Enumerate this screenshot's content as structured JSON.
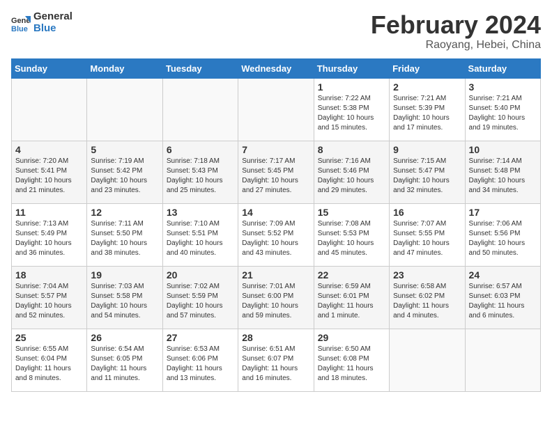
{
  "header": {
    "logo_line1": "General",
    "logo_line2": "Blue",
    "month_year": "February 2024",
    "location": "Raoyang, Hebei, China"
  },
  "weekdays": [
    "Sunday",
    "Monday",
    "Tuesday",
    "Wednesday",
    "Thursday",
    "Friday",
    "Saturday"
  ],
  "weeks": [
    [
      {
        "day": "",
        "info": ""
      },
      {
        "day": "",
        "info": ""
      },
      {
        "day": "",
        "info": ""
      },
      {
        "day": "",
        "info": ""
      },
      {
        "day": "1",
        "info": "Sunrise: 7:22 AM\nSunset: 5:38 PM\nDaylight: 10 hours\nand 15 minutes."
      },
      {
        "day": "2",
        "info": "Sunrise: 7:21 AM\nSunset: 5:39 PM\nDaylight: 10 hours\nand 17 minutes."
      },
      {
        "day": "3",
        "info": "Sunrise: 7:21 AM\nSunset: 5:40 PM\nDaylight: 10 hours\nand 19 minutes."
      }
    ],
    [
      {
        "day": "4",
        "info": "Sunrise: 7:20 AM\nSunset: 5:41 PM\nDaylight: 10 hours\nand 21 minutes."
      },
      {
        "day": "5",
        "info": "Sunrise: 7:19 AM\nSunset: 5:42 PM\nDaylight: 10 hours\nand 23 minutes."
      },
      {
        "day": "6",
        "info": "Sunrise: 7:18 AM\nSunset: 5:43 PM\nDaylight: 10 hours\nand 25 minutes."
      },
      {
        "day": "7",
        "info": "Sunrise: 7:17 AM\nSunset: 5:45 PM\nDaylight: 10 hours\nand 27 minutes."
      },
      {
        "day": "8",
        "info": "Sunrise: 7:16 AM\nSunset: 5:46 PM\nDaylight: 10 hours\nand 29 minutes."
      },
      {
        "day": "9",
        "info": "Sunrise: 7:15 AM\nSunset: 5:47 PM\nDaylight: 10 hours\nand 32 minutes."
      },
      {
        "day": "10",
        "info": "Sunrise: 7:14 AM\nSunset: 5:48 PM\nDaylight: 10 hours\nand 34 minutes."
      }
    ],
    [
      {
        "day": "11",
        "info": "Sunrise: 7:13 AM\nSunset: 5:49 PM\nDaylight: 10 hours\nand 36 minutes."
      },
      {
        "day": "12",
        "info": "Sunrise: 7:11 AM\nSunset: 5:50 PM\nDaylight: 10 hours\nand 38 minutes."
      },
      {
        "day": "13",
        "info": "Sunrise: 7:10 AM\nSunset: 5:51 PM\nDaylight: 10 hours\nand 40 minutes."
      },
      {
        "day": "14",
        "info": "Sunrise: 7:09 AM\nSunset: 5:52 PM\nDaylight: 10 hours\nand 43 minutes."
      },
      {
        "day": "15",
        "info": "Sunrise: 7:08 AM\nSunset: 5:53 PM\nDaylight: 10 hours\nand 45 minutes."
      },
      {
        "day": "16",
        "info": "Sunrise: 7:07 AM\nSunset: 5:55 PM\nDaylight: 10 hours\nand 47 minutes."
      },
      {
        "day": "17",
        "info": "Sunrise: 7:06 AM\nSunset: 5:56 PM\nDaylight: 10 hours\nand 50 minutes."
      }
    ],
    [
      {
        "day": "18",
        "info": "Sunrise: 7:04 AM\nSunset: 5:57 PM\nDaylight: 10 hours\nand 52 minutes."
      },
      {
        "day": "19",
        "info": "Sunrise: 7:03 AM\nSunset: 5:58 PM\nDaylight: 10 hours\nand 54 minutes."
      },
      {
        "day": "20",
        "info": "Sunrise: 7:02 AM\nSunset: 5:59 PM\nDaylight: 10 hours\nand 57 minutes."
      },
      {
        "day": "21",
        "info": "Sunrise: 7:01 AM\nSunset: 6:00 PM\nDaylight: 10 hours\nand 59 minutes."
      },
      {
        "day": "22",
        "info": "Sunrise: 6:59 AM\nSunset: 6:01 PM\nDaylight: 11 hours\nand 1 minute."
      },
      {
        "day": "23",
        "info": "Sunrise: 6:58 AM\nSunset: 6:02 PM\nDaylight: 11 hours\nand 4 minutes."
      },
      {
        "day": "24",
        "info": "Sunrise: 6:57 AM\nSunset: 6:03 PM\nDaylight: 11 hours\nand 6 minutes."
      }
    ],
    [
      {
        "day": "25",
        "info": "Sunrise: 6:55 AM\nSunset: 6:04 PM\nDaylight: 11 hours\nand 8 minutes."
      },
      {
        "day": "26",
        "info": "Sunrise: 6:54 AM\nSunset: 6:05 PM\nDaylight: 11 hours\nand 11 minutes."
      },
      {
        "day": "27",
        "info": "Sunrise: 6:53 AM\nSunset: 6:06 PM\nDaylight: 11 hours\nand 13 minutes."
      },
      {
        "day": "28",
        "info": "Sunrise: 6:51 AM\nSunset: 6:07 PM\nDaylight: 11 hours\nand 16 minutes."
      },
      {
        "day": "29",
        "info": "Sunrise: 6:50 AM\nSunset: 6:08 PM\nDaylight: 11 hours\nand 18 minutes."
      },
      {
        "day": "",
        "info": ""
      },
      {
        "day": "",
        "info": ""
      }
    ]
  ]
}
